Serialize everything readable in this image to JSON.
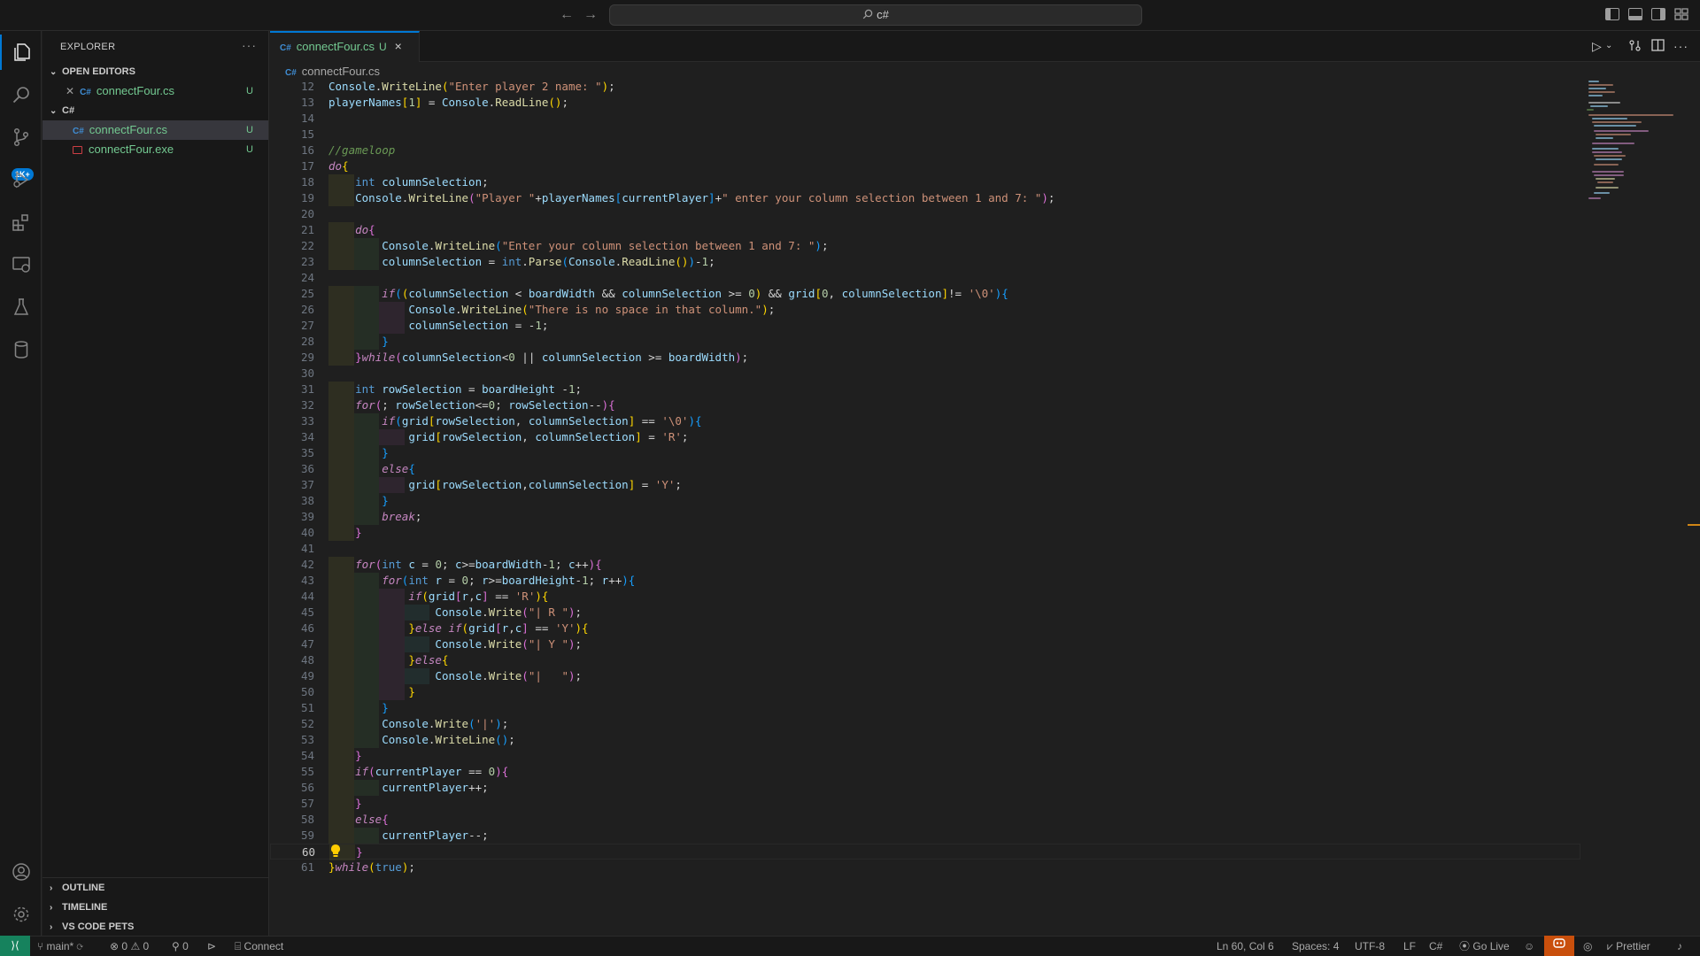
{
  "titlebar": {
    "search_text": "c#"
  },
  "activity": {
    "items": [
      "explorer-icon",
      "search-icon",
      "source-control-icon",
      "run-debug-icon",
      "extensions-icon",
      "remote-explorer-icon",
      "testing-icon",
      "database-icon"
    ],
    "scm_badge": "1K+"
  },
  "sidebar": {
    "title": "EXPLORER",
    "open_editors_label": "OPEN EDITORS",
    "open_editors": [
      {
        "name": "connectFour.cs",
        "status": "U",
        "lang": "C#"
      }
    ],
    "folder_label": "C#",
    "files": [
      {
        "name": "connectFour.cs",
        "status": "U",
        "lang": "C#"
      },
      {
        "name": "connectFour.exe",
        "status": "U"
      }
    ],
    "panels": [
      "OUTLINE",
      "TIMELINE",
      "VS CODE PETS"
    ]
  },
  "editor": {
    "tab": {
      "lang": "C#",
      "name": "connectFour.cs",
      "status": "U"
    },
    "breadcrumb": {
      "lang": "C#",
      "name": "connectFour.cs"
    },
    "current_line": 60,
    "lines": [
      {
        "n": 12,
        "html": "<span class=\"va\">Console</span>.<span class=\"fn\">WriteLine</span><span class=\"br\">(</span><span class=\"st\">\"Enter player 2 name: \"</span><span class=\"br\">)</span>;"
      },
      {
        "n": 13,
        "html": "<span class=\"va\">playerNames</span><span class=\"br\">[</span><span class=\"nm\">1</span><span class=\"br\">]</span> = <span class=\"va\">Console</span>.<span class=\"fn\">ReadLine</span><span class=\"br\">()</span>;"
      },
      {
        "n": 14,
        "html": ""
      },
      {
        "n": 15,
        "html": ""
      },
      {
        "n": 16,
        "html": "<span class=\"cm\">//gameloop</span>"
      },
      {
        "n": 17,
        "html": "<span class=\"kw\">do</span><span class=\"br\">{</span>"
      },
      {
        "n": 18,
        "html": "    <span class=\"ty\">int</span> <span class=\"va\">columnSelection</span>;"
      },
      {
        "n": 19,
        "html": "    <span class=\"va\">Console</span>.<span class=\"fn\">WriteLine</span><span class=\"br2\">(</span><span class=\"st\">\"Player \"</span>+<span class=\"va\">playerNames</span><span class=\"br3\">[</span><span class=\"va\">currentPlayer</span><span class=\"br3\">]</span>+<span class=\"st\">\" enter your column selection between 1 and 7: \"</span><span class=\"br2\">)</span>;"
      },
      {
        "n": 20,
        "html": ""
      },
      {
        "n": 21,
        "html": "    <span class=\"kw\">do</span><span class=\"br2\">{</span>"
      },
      {
        "n": 22,
        "html": "        <span class=\"va\">Console</span>.<span class=\"fn\">WriteLine</span><span class=\"br3\">(</span><span class=\"st\">\"Enter your column selection between 1 and 7: \"</span><span class=\"br3\">)</span>;"
      },
      {
        "n": 23,
        "html": "        <span class=\"va\">columnSelection</span> = <span class=\"ty\">int</span>.<span class=\"fn\">Parse</span><span class=\"br3\">(</span><span class=\"va\">Console</span>.<span class=\"fn\">ReadLine</span><span class=\"br\">()</span><span class=\"br3\">)</span>-<span class=\"nm\">1</span>;"
      },
      {
        "n": 24,
        "html": ""
      },
      {
        "n": 25,
        "html": "        <span class=\"kw\">if</span><span class=\"br3\">(</span><span class=\"br\">(</span><span class=\"va\">columnSelection</span> &lt; <span class=\"va\">boardWidth</span> &amp;&amp; <span class=\"va\">columnSelection</span> &gt;= <span class=\"nm\">0</span><span class=\"br\">)</span> &amp;&amp; <span class=\"va\">grid</span><span class=\"br\">[</span><span class=\"nm\">0</span>, <span class=\"va\">columnSelection</span><span class=\"br\">]</span>!= <span class=\"st\">'\\0'</span><span class=\"br3\">)</span><span class=\"br3\">{</span>"
      },
      {
        "n": 26,
        "html": "            <span class=\"va\">Console</span>.<span class=\"fn\">WriteLine</span><span class=\"br\">(</span><span class=\"st\">\"There is no space in that column.\"</span><span class=\"br\">)</span>;"
      },
      {
        "n": 27,
        "html": "            <span class=\"va\">columnSelection</span> = -<span class=\"nm\">1</span>;"
      },
      {
        "n": 28,
        "html": "        <span class=\"br3\">}</span>"
      },
      {
        "n": 29,
        "html": "    <span class=\"br2\">}</span><span class=\"kw\">while</span><span class=\"br2\">(</span><span class=\"va\">columnSelection</span>&lt;<span class=\"nm\">0</span> || <span class=\"va\">columnSelection</span> &gt;= <span class=\"va\">boardWidth</span><span class=\"br2\">)</span>;"
      },
      {
        "n": 30,
        "html": ""
      },
      {
        "n": 31,
        "html": "    <span class=\"ty\">int</span> <span class=\"va\">rowSelection</span> = <span class=\"va\">boardHeight</span> -<span class=\"nm\">1</span>;"
      },
      {
        "n": 32,
        "html": "    <span class=\"kw\">for</span><span class=\"br2\">(</span>; <span class=\"va\">rowSelection</span>&lt;=<span class=\"nm\">0</span>; <span class=\"va\">rowSelection</span>--<span class=\"br2\">)</span><span class=\"br2\">{</span>"
      },
      {
        "n": 33,
        "html": "        <span class=\"kw\">if</span><span class=\"br3\">(</span><span class=\"va\">grid</span><span class=\"br\">[</span><span class=\"va\">rowSelection</span>, <span class=\"va\">columnSelection</span><span class=\"br\">]</span> == <span class=\"st\">'\\0'</span><span class=\"br3\">)</span><span class=\"br3\">{</span>"
      },
      {
        "n": 34,
        "html": "            <span class=\"va\">grid</span><span class=\"br\">[</span><span class=\"va\">rowSelection</span>, <span class=\"va\">columnSelection</span><span class=\"br\">]</span> = <span class=\"st\">'R'</span>;"
      },
      {
        "n": 35,
        "html": "        <span class=\"br3\">}</span>"
      },
      {
        "n": 36,
        "html": "        <span class=\"kw\">else</span><span class=\"br3\">{</span>"
      },
      {
        "n": 37,
        "html": "            <span class=\"va\">grid</span><span class=\"br\">[</span><span class=\"va\">rowSelection</span>,<span class=\"va\">columnSelection</span><span class=\"br\">]</span> = <span class=\"st\">'Y'</span>;"
      },
      {
        "n": 38,
        "html": "        <span class=\"br3\">}</span>"
      },
      {
        "n": 39,
        "html": "        <span class=\"kw\">break</span>;"
      },
      {
        "n": 40,
        "html": "    <span class=\"br2\">}</span>"
      },
      {
        "n": 41,
        "html": ""
      },
      {
        "n": 42,
        "html": "    <span class=\"kw\">for</span><span class=\"br2\">(</span><span class=\"ty\">int</span> <span class=\"va\">c</span> = <span class=\"nm\">0</span>; <span class=\"va\">c</span>&gt;=<span class=\"va\">boardWidth</span>-<span class=\"nm\">1</span>; <span class=\"va\">c</span>++<span class=\"br2\">)</span><span class=\"br2\">{</span>"
      },
      {
        "n": 43,
        "html": "        <span class=\"kw\">for</span><span class=\"br3\">(</span><span class=\"ty\">int</span> <span class=\"va\">r</span> = <span class=\"nm\">0</span>; <span class=\"va\">r</span>&gt;=<span class=\"va\">boardHeight</span>-<span class=\"nm\">1</span>; <span class=\"va\">r</span>++<span class=\"br3\">)</span><span class=\"br3\">{</span>"
      },
      {
        "n": 44,
        "html": "            <span class=\"kw\">if</span><span class=\"br\">(</span><span class=\"va\">grid</span><span class=\"br2\">[</span><span class=\"va\">r</span>,<span class=\"va\">c</span><span class=\"br2\">]</span> == <span class=\"st\">'R'</span><span class=\"br\">)</span><span class=\"br\">{</span>"
      },
      {
        "n": 45,
        "html": "                <span class=\"va\">Console</span>.<span class=\"fn\">Write</span><span class=\"br2\">(</span><span class=\"st\">\"| R \"</span><span class=\"br2\">)</span>;"
      },
      {
        "n": 46,
        "html": "            <span class=\"br\">}</span><span class=\"kw\">else if</span><span class=\"br\">(</span><span class=\"va\">grid</span><span class=\"br2\">[</span><span class=\"va\">r</span>,<span class=\"va\">c</span><span class=\"br2\">]</span> == <span class=\"st\">'Y'</span><span class=\"br\">)</span><span class=\"br\">{</span>"
      },
      {
        "n": 47,
        "html": "                <span class=\"va\">Console</span>.<span class=\"fn\">Write</span><span class=\"br2\">(</span><span class=\"st\">\"| Y \"</span><span class=\"br2\">)</span>;"
      },
      {
        "n": 48,
        "html": "            <span class=\"br\">}</span><span class=\"kw\">else</span><span class=\"br\">{</span>"
      },
      {
        "n": 49,
        "html": "                <span class=\"va\">Console</span>.<span class=\"fn\">Write</span><span class=\"br2\">(</span><span class=\"st\">\"|   \"</span><span class=\"br2\">)</span>;"
      },
      {
        "n": 50,
        "html": "            <span class=\"br\">}</span>"
      },
      {
        "n": 51,
        "html": "        <span class=\"br3\">}</span>"
      },
      {
        "n": 52,
        "html": "        <span class=\"va\">Console</span>.<span class=\"fn\">Write</span><span class=\"br3\">(</span><span class=\"st\">'|'</span><span class=\"br3\">)</span>;"
      },
      {
        "n": 53,
        "html": "        <span class=\"va\">Console</span>.<span class=\"fn\">WriteLine</span><span class=\"br3\">()</span>;"
      },
      {
        "n": 54,
        "html": "    <span class=\"br2\">}</span>"
      },
      {
        "n": 55,
        "html": "    <span class=\"kw\">if</span><span class=\"br2\">(</span><span class=\"va\">currentPlayer</span> == <span class=\"nm\">0</span><span class=\"br2\">)</span><span class=\"br2\">{</span>"
      },
      {
        "n": 56,
        "html": "        <span class=\"va\">currentPlayer</span>++;"
      },
      {
        "n": 57,
        "html": "    <span class=\"br2\">}</span>"
      },
      {
        "n": 58,
        "html": "    <span class=\"kw\">else</span><span class=\"br2\">{</span>"
      },
      {
        "n": 59,
        "html": "        <span class=\"va\">currentPlayer</span>--;"
      },
      {
        "n": 60,
        "html": "    <span class=\"br2\">}</span>"
      },
      {
        "n": 61,
        "html": "<span class=\"br\">}</span><span class=\"kw\">while</span><span class=\"br\">(</span><span class=\"ty\">true</span><span class=\"br\">)</span>;"
      }
    ]
  },
  "statusbar": {
    "branch": "main*",
    "errors": "0",
    "warnings": "0",
    "ports": "0",
    "connect": "Connect",
    "position": "Ln 60, Col 6",
    "spaces": "Spaces: 4",
    "encoding": "UTF-8",
    "eol": "LF",
    "language": "C#",
    "golive": "Go Live",
    "prettier": "Prettier"
  },
  "colors": {
    "accent": "#0078d4",
    "untracked": "#73c991",
    "remote_bg": "#16825d",
    "copilot_bg": "#c94f0c"
  }
}
